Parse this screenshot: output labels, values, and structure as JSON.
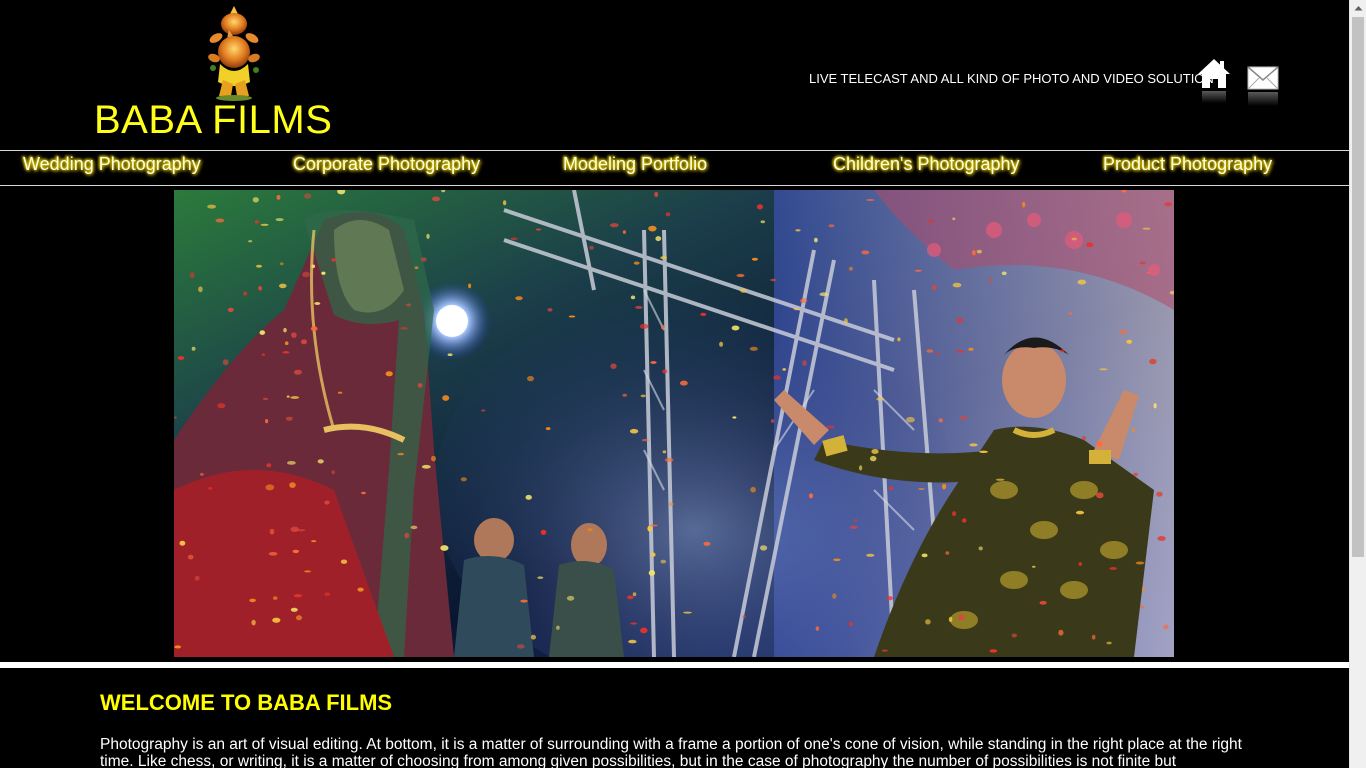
{
  "header": {
    "site_title": "BABA FILMS",
    "tagline": "LIVE TELECAST AND ALL KIND OF PHOTO AND VIDEO SOLUTION",
    "logo_icon": "ganesha-figure",
    "home_icon": "home-icon",
    "mail_icon": "mail-icon"
  },
  "nav": {
    "items": [
      {
        "label": "Wedding Photography"
      },
      {
        "label": "Corporate Photography"
      },
      {
        "label": "Modeling Portfolio"
      },
      {
        "label": "Children's Photography"
      },
      {
        "label": "Product Photography"
      }
    ]
  },
  "main": {
    "welcome_heading": "WELCOME TO BABA FILMS",
    "intro_text": "Photography is an art of visual editing. At bottom, it is a matter of surrounding with a frame a portion of one's cone of vision, while standing in the right place at the right time. Like chess, or writing, it is a matter of choosing from among given possibilities, but in the case of photography the number of possibilities is not finite but"
  },
  "colors": {
    "background": "#000000",
    "title": "#ffff1a",
    "heading": "#ffff00",
    "nav_glow": "#e6d000",
    "text": "#ffffff"
  }
}
